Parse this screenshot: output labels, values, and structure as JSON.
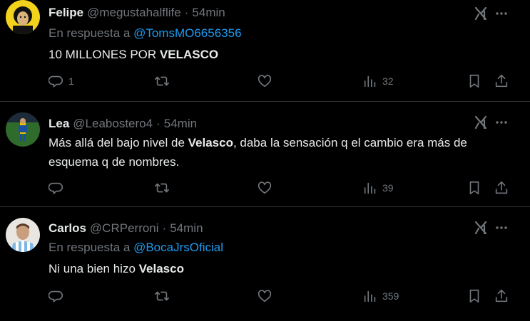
{
  "colors": {
    "background": "#000000",
    "text": "#e7e9ea",
    "muted": "#71767b",
    "link": "#1d9bf0",
    "divider": "#2f3336"
  },
  "tweets": [
    {
      "name": "Felipe",
      "handle": "@megustahalflife",
      "dot": "·",
      "time": "54min",
      "reply_prefix": "En respuesta a ",
      "reply_to": "@TomsMO6656356",
      "body_text": "10 MILLONES POR ",
      "body_bold": "VELASCO",
      "body_after": "",
      "icons": [
        "grok-icon",
        "more-icon",
        "reply-icon",
        "repost-icon",
        "like-icon",
        "views-icon",
        "bookmark-icon",
        "share-icon"
      ],
      "replies": "1",
      "reposts": "",
      "likes": "",
      "views": "32"
    },
    {
      "name": "Lea",
      "handle": "@Leabostero4",
      "dot": "·",
      "time": "54min",
      "body_text": "Más allá del bajo nivel de ",
      "body_bold": "Velasco",
      "body_after": ", daba la sensación q el cambio era más de esquema q de nombres.",
      "icons": [
        "grok-icon",
        "more-icon",
        "reply-icon",
        "repost-icon",
        "like-icon",
        "views-icon",
        "bookmark-icon",
        "share-icon"
      ],
      "replies": "",
      "reposts": "",
      "likes": "",
      "views": "39"
    },
    {
      "name": "Carlos",
      "handle": "@CRPerroni",
      "dot": "·",
      "time": "54min",
      "reply_prefix": "En respuesta a ",
      "reply_to": "@BocaJrsOficial",
      "body_text": "Ni una bien hizo ",
      "body_bold": "Velasco",
      "body_after": "",
      "icons": [
        "grok-icon",
        "more-icon",
        "reply-icon",
        "repost-icon",
        "like-icon",
        "views-icon",
        "bookmark-icon",
        "share-icon"
      ],
      "replies": "",
      "reposts": "",
      "likes": "",
      "views": "359"
    }
  ]
}
